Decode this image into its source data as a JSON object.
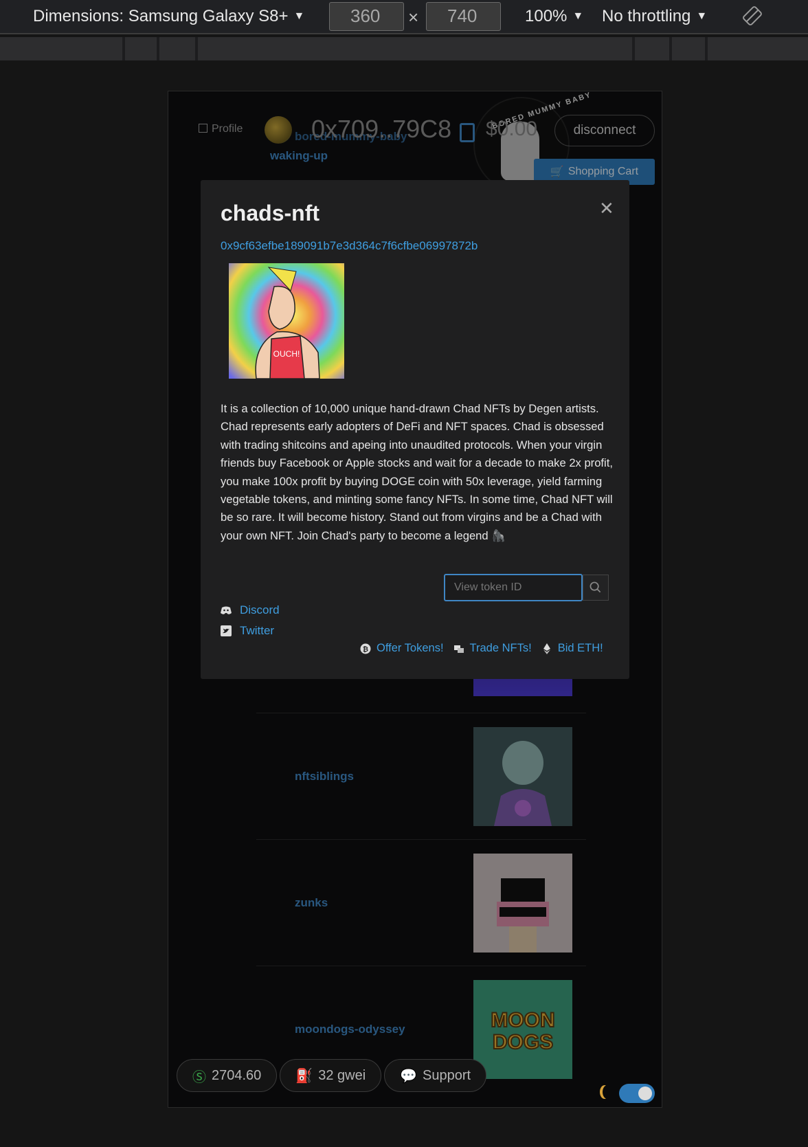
{
  "devtools": {
    "device_label": "Dimensions: Samsung Galaxy S8+",
    "width": "360",
    "height": "740",
    "times": "×",
    "zoom": "100%",
    "throttle": "No throttling"
  },
  "header": {
    "profile": "Profile",
    "collection_link_1": "bored-mummy-baby",
    "collection_link_2": "waking-up",
    "address": "0x709..79C8",
    "balance": "$0.00",
    "disconnect": "disconnect",
    "cart": "Shopping Cart",
    "logo_text": "BORED MUMMY BABY"
  },
  "collections": [
    {
      "name": "nftsiblings"
    },
    {
      "name": "zunks"
    },
    {
      "name": "moondogs-odyssey"
    }
  ],
  "footer": {
    "eth_price": "2704.60",
    "gas": "32 gwei",
    "support": "Support"
  },
  "modal": {
    "title": "chads-nft",
    "contract": "0x9cf63efbe189091b7e3d364c7f6cfbe06997872b",
    "description": "It is a collection of 10,000 unique hand-drawn Chad NFTs by Degen artists. Chad represents early adopters of DeFi and NFT spaces. Chad is obsessed with trading shitcoins and apeing into unaudited protocols. When your virgin friends buy Facebook or Apple stocks and wait for a decade to make 2x profit, you make 100x profit by buying DOGE coin with 50x leverage, yield farming vegetable tokens, and minting some fancy NFTs. In some time, Chad NFT will be so rare. It will become history. Stand out from virgins and be a Chad with your own NFT. Join Chad's party to become a legend 🦍",
    "token_placeholder": "View token ID",
    "discord": "Discord",
    "twitter": "Twitter",
    "offer": "Offer Tokens!",
    "trade": "Trade NFTs!",
    "bid": "Bid ETH!",
    "image_text": "OUCH!"
  }
}
